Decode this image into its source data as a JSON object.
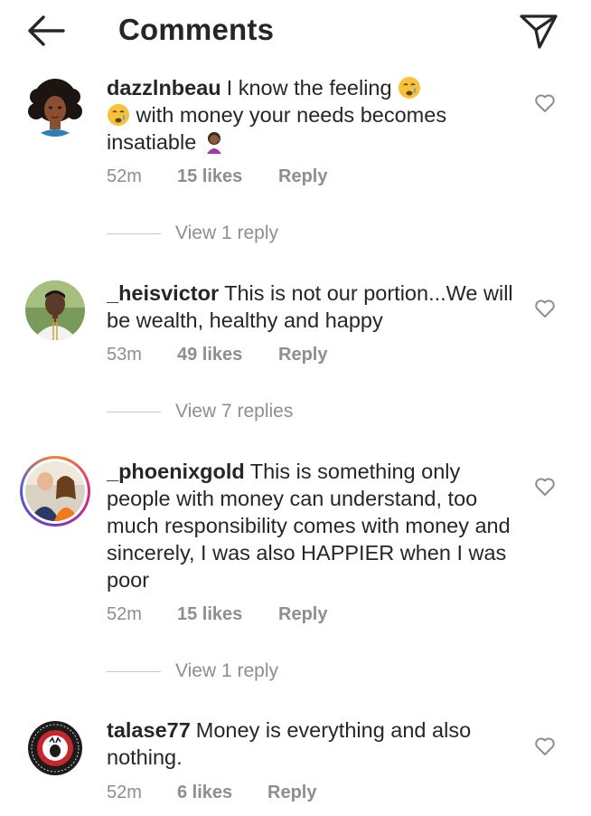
{
  "header": {
    "title": "Comments",
    "back_icon": "arrow-left-icon",
    "share_icon": "paper-plane-icon"
  },
  "comments": [
    {
      "username": "dazzlnbeau",
      "text_parts": [
        "I know the feeling",
        "with money your needs becomes insatiable"
      ],
      "emojis": [
        "crying-face",
        "crying-face",
        "woman-facepalming"
      ],
      "time": "52m",
      "likes": "15 likes",
      "reply": "Reply",
      "view_replies": "View 1 reply"
    },
    {
      "username": "_heisvictor",
      "text": "This is not our portion...We will be wealth, healthy and happy",
      "time": "53m",
      "likes": "49 likes",
      "reply": "Reply",
      "view_replies": "View 7 replies"
    },
    {
      "username": "_phoenixgold",
      "text": "This is something only people with money can understand, too much responsibility comes with money and sincerely, I was also HAPPIER when I was poor",
      "time": "52m",
      "likes": "15 likes",
      "reply": "Reply",
      "view_replies": "View 1 reply"
    },
    {
      "username": "talase77",
      "text": "Money is everything and also nothing.",
      "time": "52m",
      "likes": "6 likes",
      "reply": "Reply"
    }
  ],
  "colors": {
    "text": "#262626",
    "secondary": "#8e8e8e",
    "story_ring": [
      "#f58529",
      "#dd2a7b",
      "#8134af",
      "#515bd4"
    ]
  }
}
